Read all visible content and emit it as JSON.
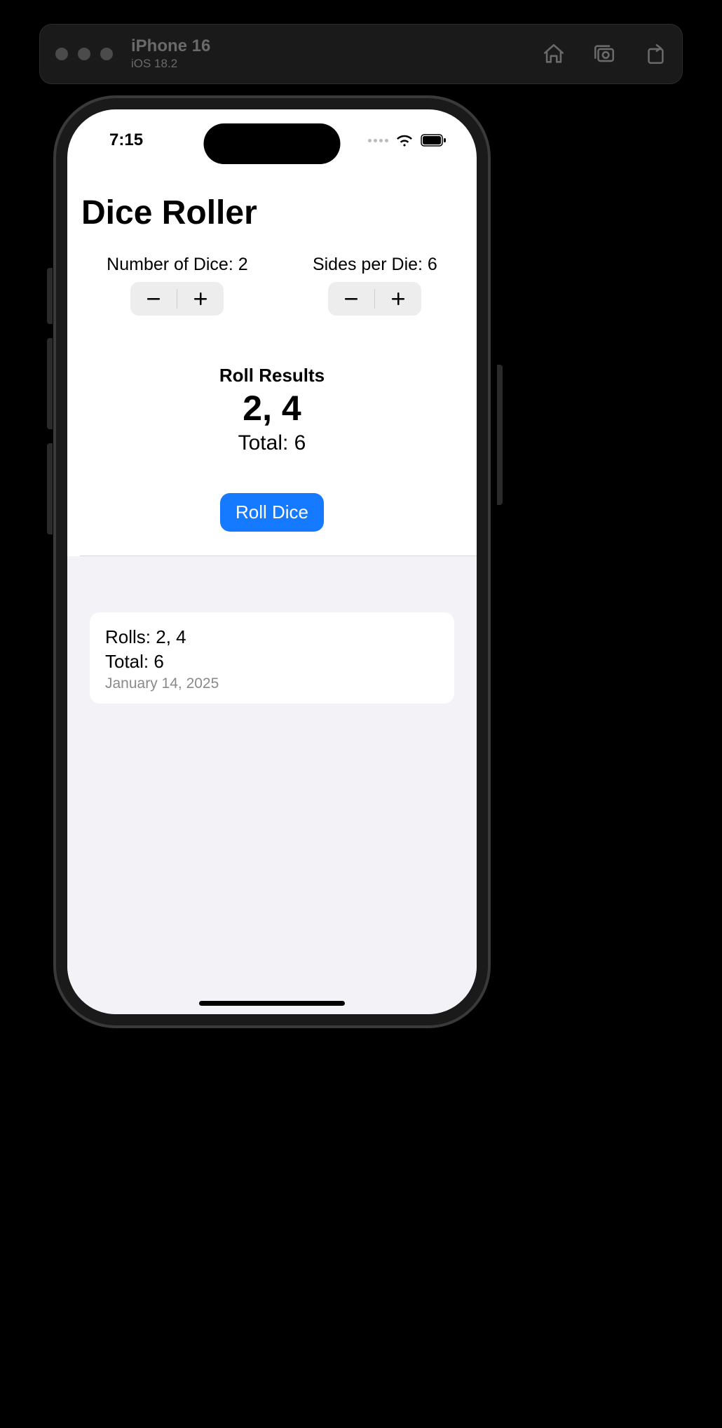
{
  "simulator": {
    "device": "iPhone 16",
    "os": "iOS 18.2"
  },
  "status": {
    "time": "7:15"
  },
  "app": {
    "title": "Dice Roller",
    "numDiceLabel": "Number of Dice: 2",
    "sidesLabel": "Sides per Die: 6",
    "results": {
      "heading": "Roll Results",
      "values": "2, 4",
      "total": "Total: 6"
    },
    "rollButton": "Roll Dice",
    "history": [
      {
        "rolls": "Rolls: 2, 4",
        "total": "Total: 6",
        "date": "January 14, 2025"
      }
    ]
  },
  "colors": {
    "accent": "#157aff",
    "historyBg": "#f2f2f7"
  }
}
